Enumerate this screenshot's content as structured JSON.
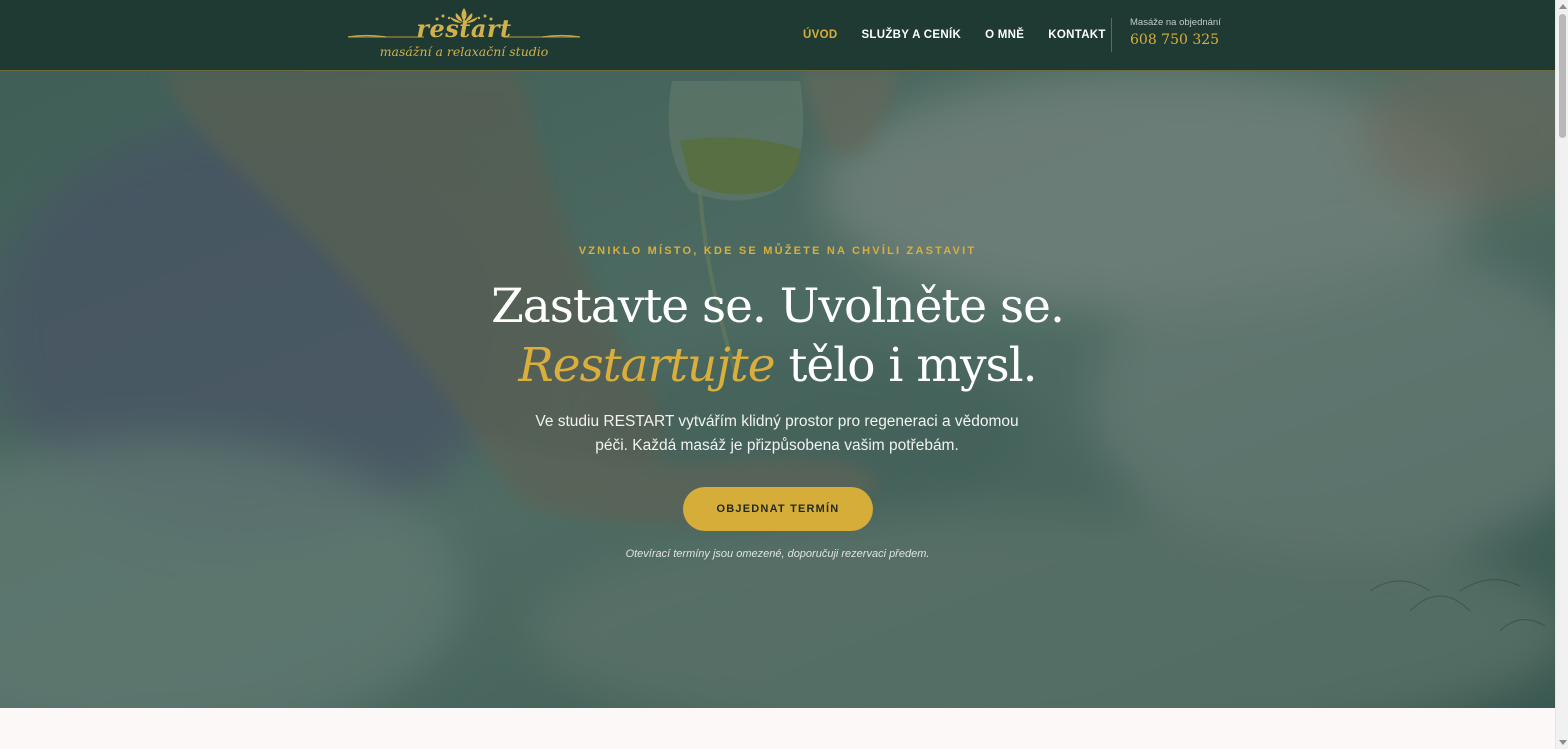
{
  "header": {
    "logo": {
      "wordmark": "restart",
      "tagline": "masážní a relaxační studio",
      "icon": "lotus-icon"
    },
    "nav": [
      {
        "label": "ÚVOD",
        "active": true
      },
      {
        "label": "SLUŽBY A CENÍK",
        "active": false
      },
      {
        "label": "O MNĚ",
        "active": false
      },
      {
        "label": "KONTAKT",
        "active": false
      }
    ],
    "phone_label": "Masáže na objednání",
    "phone_number": "608 750 325"
  },
  "hero": {
    "eyebrow": "VZNIKLO MÍSTO, KDE SE MŮŽETE NA CHVÍLI ZASTAVIT",
    "headline_line1": "Zastavte se. Uvolněte se.",
    "headline_accent": "Restartujte",
    "headline_rest": " tělo i mysl.",
    "lead": "Ve studiu RESTART vytvářím klidný prostor pro regeneraci a vědomou péči. Každá masáž je přizpůsobena vašim potřebám.",
    "cta_label": "OBJEDNAT TERMÍN",
    "note": "Otevírací termíny jsou omezené, doporučuji rezervaci předem."
  },
  "colors": {
    "header_bg": "#1e3a33",
    "accent_gold": "#d9ae3c",
    "overlay": "#1c3c34",
    "text_light": "#ffffff"
  }
}
